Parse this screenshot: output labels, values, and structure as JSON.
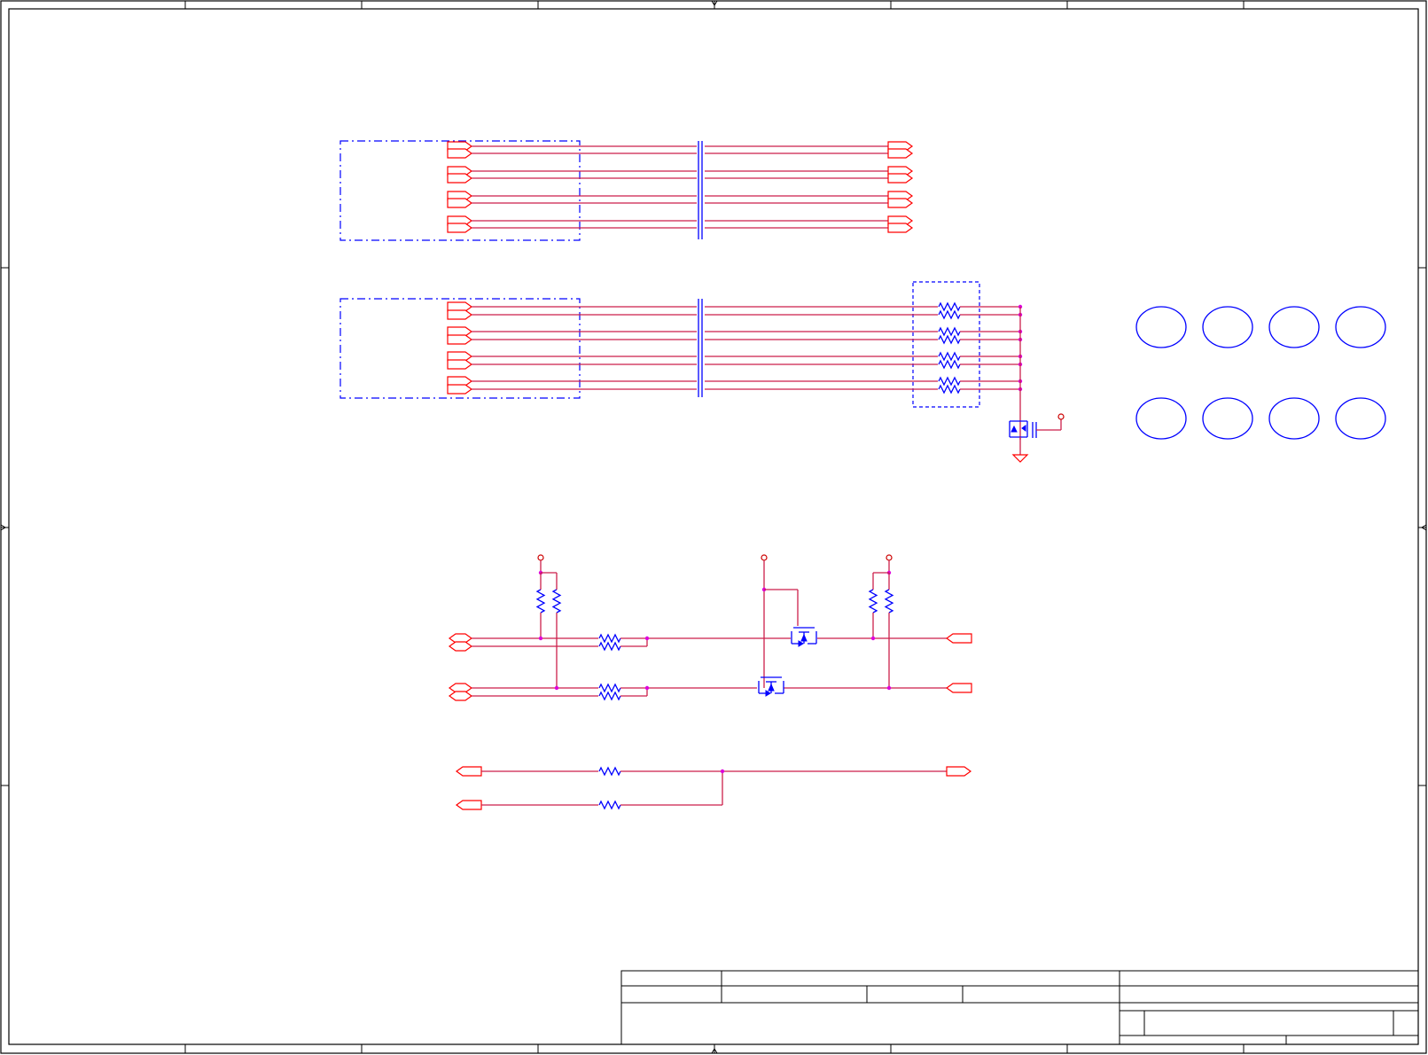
{
  "sheet": {
    "zones": {
      "columns": [
        "",
        "",
        "",
        "",
        "",
        "",
        "",
        ""
      ],
      "rows": [
        "",
        "",
        "",
        ""
      ]
    }
  },
  "colors": {
    "frame": "#000000",
    "wire": "#cc1f4a",
    "port": "#ff0000",
    "component": "#0000ff",
    "junction": "#dd00dd"
  },
  "groups": {
    "top_bus": {
      "port_pairs": 4
    },
    "mid_bus": {
      "port_pairs": 4,
      "resistor_pairs": 4
    },
    "mounting_holes": {
      "count": 8
    }
  },
  "title_block": {
    "title": "",
    "size": "",
    "document_number": "",
    "rev": "",
    "date": "",
    "sheet": ""
  }
}
